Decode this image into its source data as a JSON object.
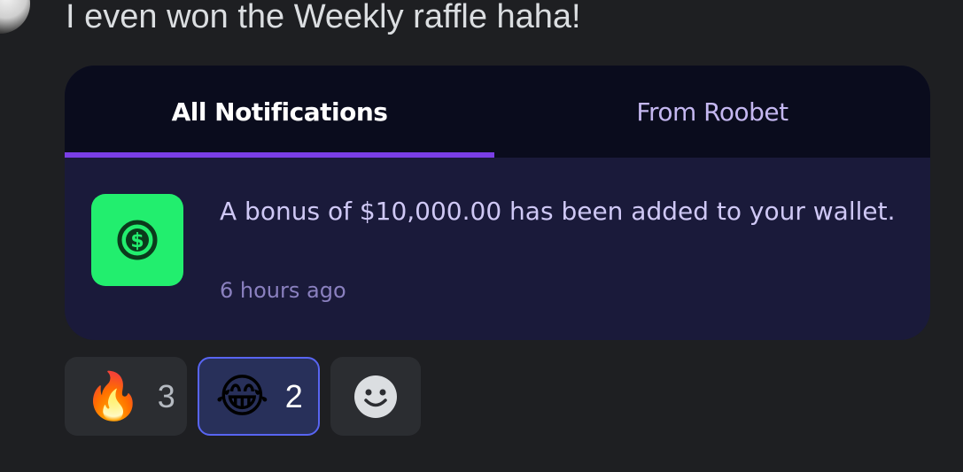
{
  "message": {
    "text": "I even won the Weekly raffle haha!"
  },
  "notifications_card": {
    "tabs": [
      {
        "label": "All Notifications",
        "active": true
      },
      {
        "label": "From Roobet",
        "active": false
      }
    ],
    "accent_color": "#7a3ee6",
    "notification": {
      "icon": "dollar-coin-icon",
      "icon_bg": "#22ee6e",
      "text": "A bonus of $10,000.00 has been added to your wallet.",
      "time": "6 hours ago"
    }
  },
  "reactions": [
    {
      "emoji": "🔥",
      "count": "3",
      "selected": false
    },
    {
      "emoji": "😂",
      "count": "2",
      "selected": true
    }
  ],
  "add_reaction": {
    "icon": "smiley-face-icon"
  }
}
